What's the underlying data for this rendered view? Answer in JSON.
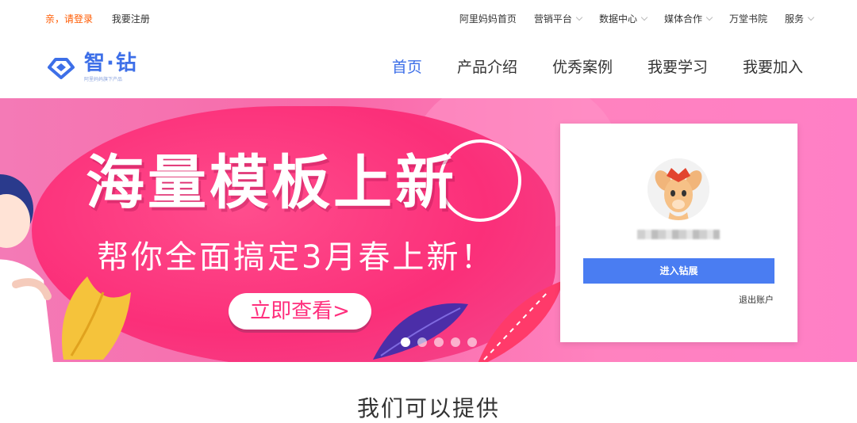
{
  "topbar": {
    "login_link": "亲，请登录",
    "register_link": "我要注册",
    "links": [
      {
        "label": "阿里妈妈首页",
        "has_dropdown": false
      },
      {
        "label": "营销平台",
        "has_dropdown": true
      },
      {
        "label": "数据中心",
        "has_dropdown": true
      },
      {
        "label": "媒体合作",
        "has_dropdown": true
      },
      {
        "label": "万堂书院",
        "has_dropdown": false
      },
      {
        "label": "服务",
        "has_dropdown": true
      }
    ]
  },
  "logo": {
    "title": "智·钻",
    "subtitle": "阿里妈妈旗下产品"
  },
  "nav": {
    "items": [
      "首页",
      "产品介绍",
      "优秀案例",
      "我要学习",
      "我要加入"
    ],
    "active_index": 0
  },
  "banner": {
    "headline": "海量模板上新",
    "subline": "帮你全面搞定3月春上新！",
    "cta": "立即查看>",
    "slides_total": 5,
    "active_slide": 0
  },
  "login_card": {
    "enter_button": "进入钻展",
    "logout_link": "退出账户"
  },
  "section": {
    "title": "我们可以提供"
  },
  "colors": {
    "brand_blue": "#3d6fe8",
    "login_orange": "#ff5a00",
    "button_blue": "#4a7df2",
    "banner_pink": "#fb2f79"
  }
}
